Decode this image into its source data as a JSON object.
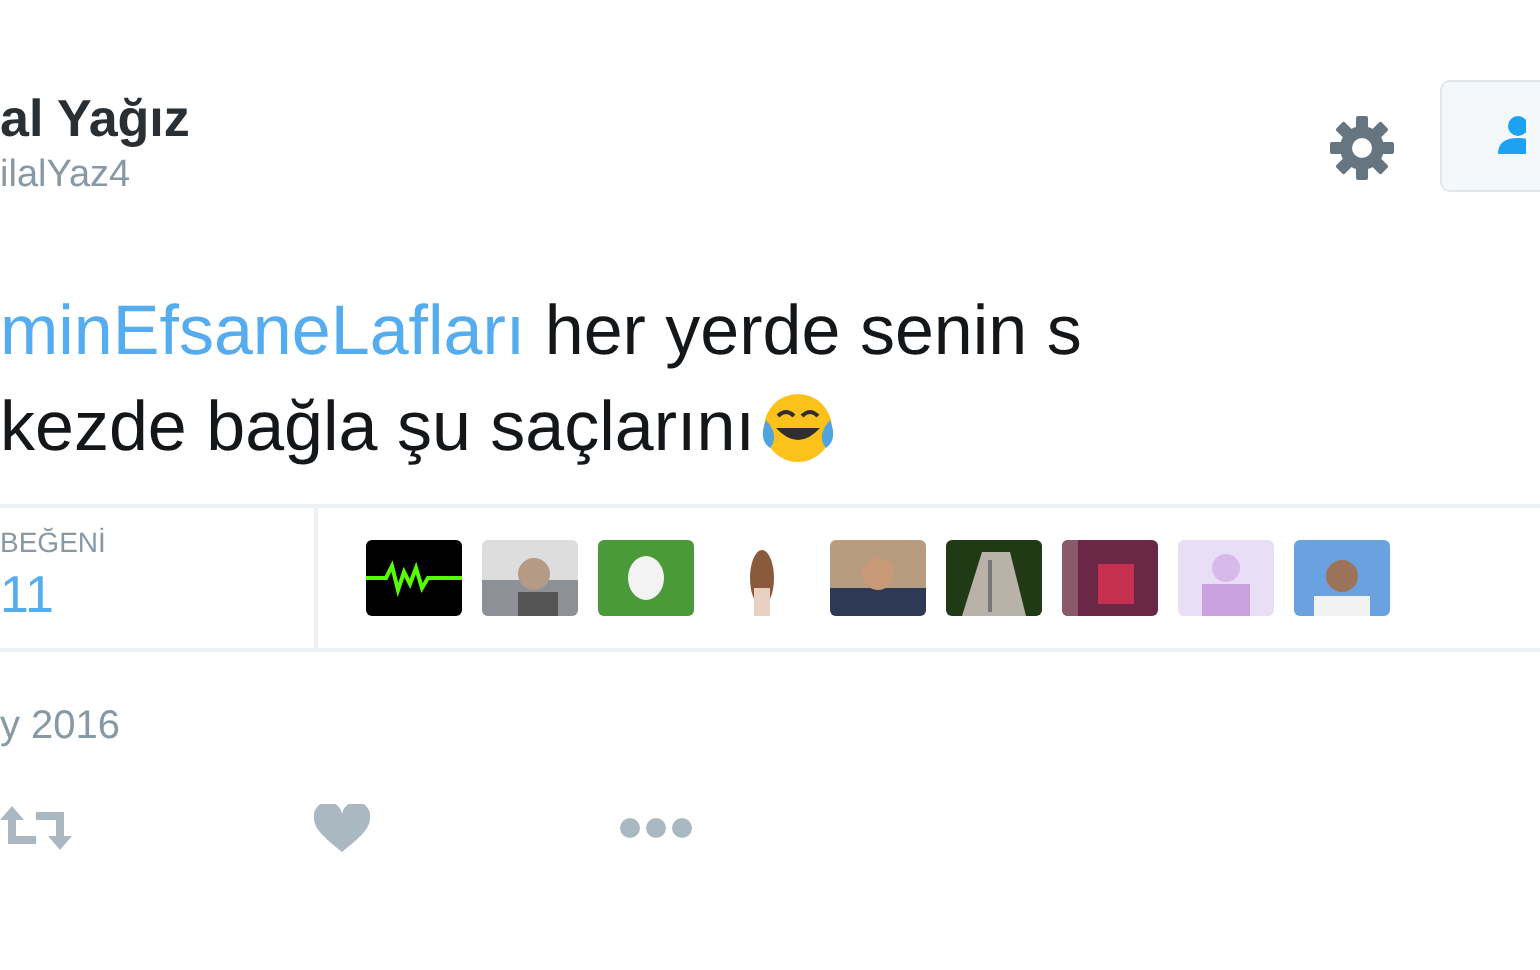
{
  "user": {
    "name": "al Yağız",
    "handle": "ilalYaz4"
  },
  "tweet": {
    "lines": [
      [
        {
          "kind": "hashtag",
          "text": "minEfsaneLafları"
        },
        {
          "kind": "plain",
          "text": " her yerde senin s"
        }
      ],
      [
        {
          "kind": "plain",
          "text": "kezde bağla şu saçlarını"
        },
        {
          "kind": "emoji"
        }
      ]
    ]
  },
  "likes": {
    "label": "BEĞENİ",
    "count": "11"
  },
  "date": "y 2016"
}
